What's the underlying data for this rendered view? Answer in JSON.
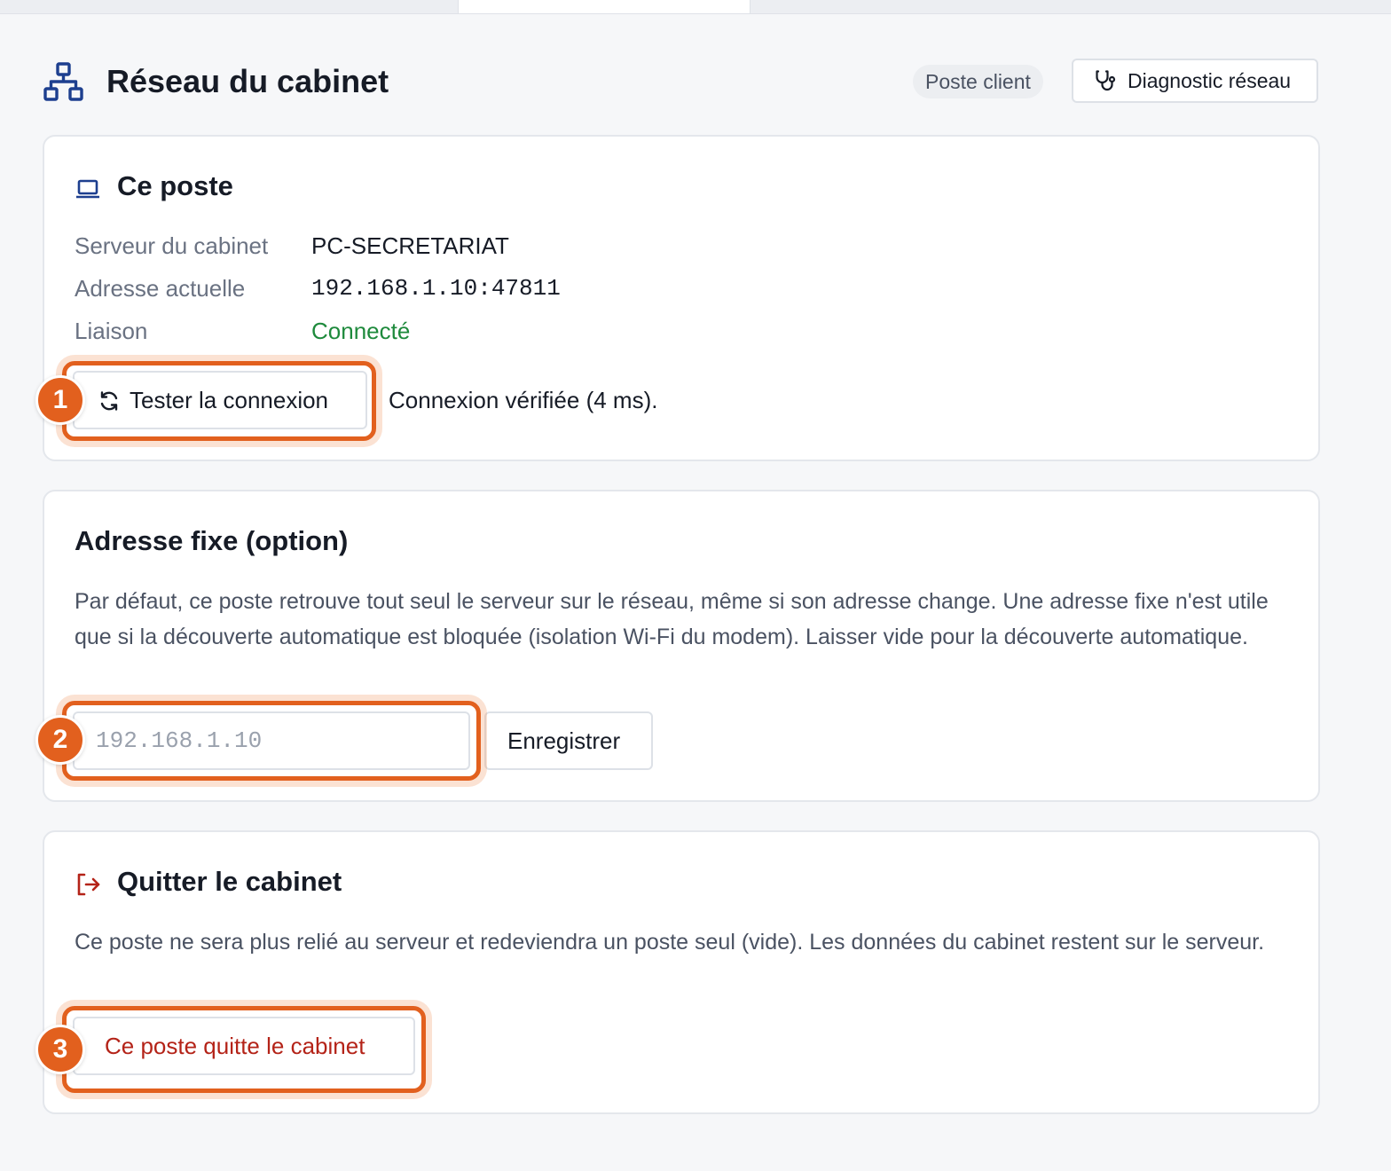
{
  "header": {
    "title": "Réseau du cabinet",
    "title_icon": "network-icon",
    "role_chip": "Poste client",
    "diagnostic_button": {
      "label": "Diagnostic réseau",
      "icon": "stethoscope-icon"
    }
  },
  "this_station": {
    "title": "Ce poste",
    "icon": "laptop-icon",
    "rows": [
      {
        "label": "Serveur du cabinet",
        "value": "PC-SECRETARIAT"
      },
      {
        "label": "Adresse actuelle",
        "value": "192.168.1.10:47811"
      },
      {
        "label": "Liaison",
        "value": "Connecté"
      }
    ],
    "test_button": {
      "label": "Tester la connexion",
      "icon": "refresh-icon"
    },
    "test_result": "Connexion vérifiée (4 ms)."
  },
  "fixed_address": {
    "title": "Adresse fixe (option)",
    "description": "Par défaut, ce poste retrouve tout seul le serveur sur le réseau, même si son adresse change. Une adresse fixe n'est utile que si la découverte automatique est bloquée (isolation Wi-Fi du modem). Laisser vide pour la découverte automatique.",
    "input": {
      "value": "",
      "placeholder": "192.168.1.10"
    },
    "save_button": "Enregistrer"
  },
  "leave": {
    "title": "Quitter le cabinet",
    "icon": "logout-icon",
    "description": "Ce poste ne sera plus relié au serveur et redeviendra un poste seul (vide). Les données du cabinet restent sur le serveur.",
    "leave_button": "Ce poste quitte le cabinet"
  },
  "annotations": [
    {
      "number": "1"
    },
    {
      "number": "2"
    },
    {
      "number": "3"
    }
  ],
  "colors": {
    "accent": "#e2601e",
    "success": "#1e8a3c",
    "danger": "#b42318",
    "background": "#f6f7f9"
  }
}
